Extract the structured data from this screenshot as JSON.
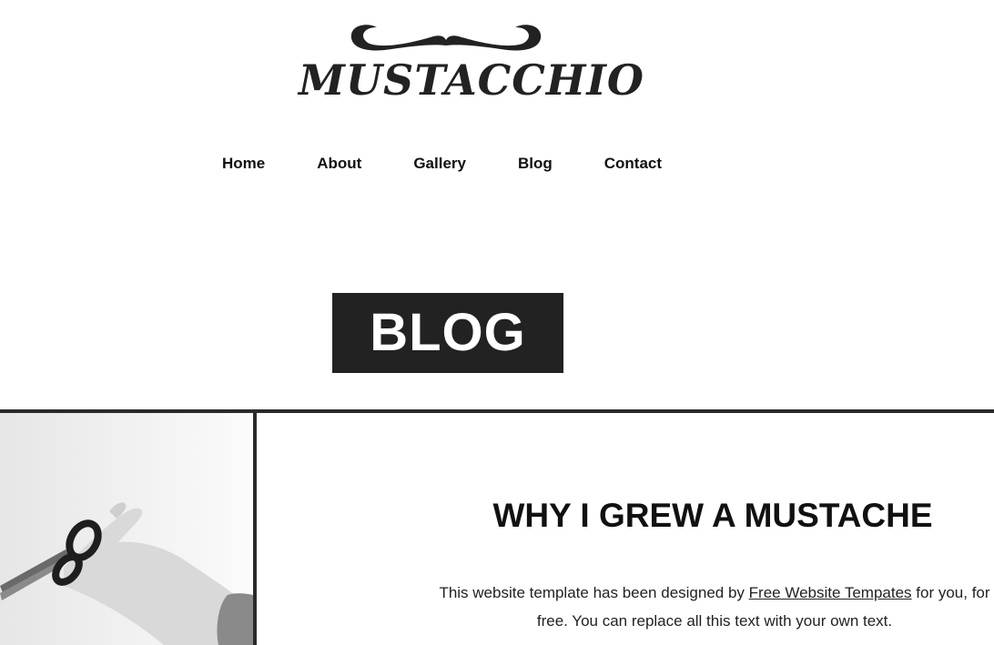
{
  "logo": {
    "text": "MUSTACCHIO",
    "icon": "mustache-icon"
  },
  "nav": {
    "items": [
      "Home",
      "About",
      "Gallery",
      "Blog",
      "Contact"
    ]
  },
  "banner": {
    "title": "BLOG"
  },
  "post": {
    "image": "scissors-photo",
    "title": "WHY I GREW A MUSTACHE",
    "body_before": "This website template has been designed by ",
    "link_text": "Free Website Tempates",
    "body_after": " for you, for free. You can replace all this text with your own text."
  },
  "colors": {
    "dark": "#222222",
    "text": "#111111",
    "background": "#ffffff"
  }
}
